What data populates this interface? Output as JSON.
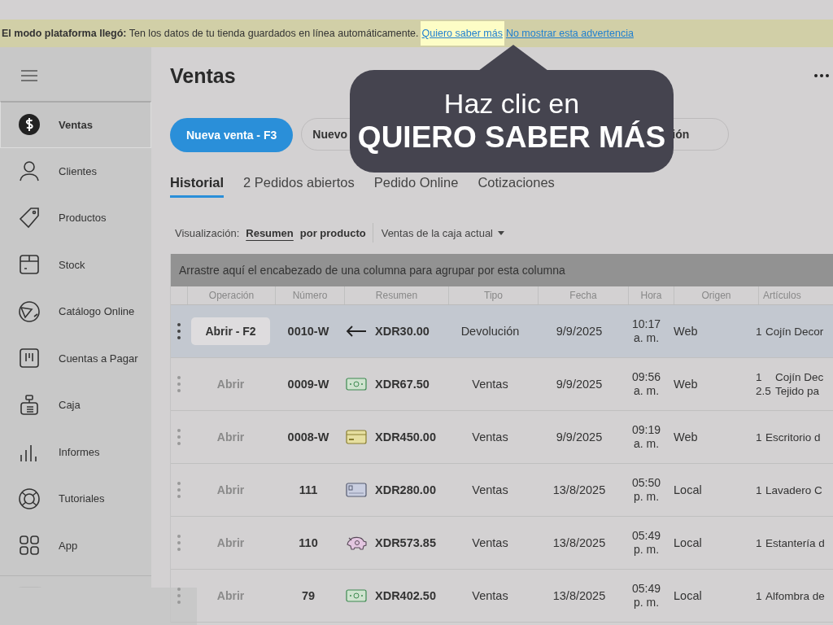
{
  "banner": {
    "message": "**El modo plataforma llegó:** Ten los datos de tu tienda guardados en línea automáticamente.",
    "links": [
      {
        "label": "Quiero saber más",
        "highlighted": true
      },
      {
        "label": "No mostrar esta advertencia",
        "highlighted": false
      }
    ]
  },
  "callout": {
    "line_1": "Haz clic en",
    "line_2": "QUIERO SABER MÁS"
  },
  "sidebar": {
    "items": [
      {
        "label": "Ventas",
        "selected": true
      },
      {
        "label": "Clientes",
        "selected": false
      },
      {
        "label": "Productos",
        "selected": false
      },
      {
        "label": "Stock",
        "selected": false
      },
      {
        "label": "Catálogo Online",
        "selected": false
      },
      {
        "label": "Cuentas a Pagar",
        "selected": false
      },
      {
        "label": "Caja",
        "selected": false
      },
      {
        "label": "Informes",
        "selected": false
      },
      {
        "label": "Tutoriales",
        "selected": false
      },
      {
        "label": "App",
        "selected": false
      }
    ]
  },
  "page": {
    "title": "Ventas"
  },
  "actions": [
    {
      "kind": "primary",
      "label": "Nueva venta - F3"
    },
    {
      "kind": "covered",
      "label": "Nuevo",
      "tail": "ión"
    }
  ],
  "tabs": [
    {
      "label": "Historial",
      "selected": true
    },
    {
      "label": "2 Pedidos abiertos",
      "selected": false
    },
    {
      "label": "Pedido Online",
      "selected": false
    },
    {
      "label": "Cotizaciones",
      "selected": false
    }
  ],
  "view": {
    "label": "Visualización:",
    "options": [
      {
        "label": "Resumen",
        "selected": true
      },
      {
        "label": "por producto",
        "selected": false
      }
    ],
    "filter": "Ventas de la caja actual"
  },
  "table": {
    "group_hint": "Arrastre aquí el encabezado de una columna para agrupar por esta columna",
    "columns": [
      "Operación",
      "Número",
      "Resumen",
      "Tipo",
      "Fecha",
      "Hora",
      "Origen",
      "Artículos"
    ],
    "rows": [
      {
        "selected": true,
        "operation": "Abrir - F2",
        "number": "0010-W",
        "kind": "return",
        "amount": "XDR30.00",
        "type": "Devolución",
        "date": "9/9/2025",
        "time": "10:17",
        "period": "a. m.",
        "origin": "Web",
        "articles": [
          {
            "qty": "1",
            "name": "Cojín Decor"
          }
        ]
      },
      {
        "selected": false,
        "operation": "Abrir",
        "number": "0009-W",
        "kind": "cash",
        "amount": "XDR67.50",
        "type": "Ventas",
        "date": "9/9/2025",
        "time": "09:56",
        "period": "a. m.",
        "origin": "Web",
        "articles": [
          {
            "qty": "1",
            "name": "Cojín Dec"
          },
          {
            "qty": "2.5",
            "name": "Tejido pa"
          }
        ]
      },
      {
        "selected": false,
        "operation": "Abrir",
        "number": "0008-W",
        "kind": "voucher",
        "amount": "XDR450.00",
        "type": "Ventas",
        "date": "9/9/2025",
        "time": "09:19",
        "period": "a. m.",
        "origin": "Web",
        "articles": [
          {
            "qty": "1",
            "name": "Escritorio d"
          }
        ]
      },
      {
        "selected": false,
        "operation": "Abrir",
        "number": "111",
        "kind": "card",
        "amount": "XDR280.00",
        "type": "Ventas",
        "date": "13/8/2025",
        "time": "05:50",
        "period": "p. m.",
        "origin": "Local",
        "articles": [
          {
            "qty": "1",
            "name": "Lavadero C"
          }
        ]
      },
      {
        "selected": false,
        "operation": "Abrir",
        "number": "110",
        "kind": "piggy",
        "amount": "XDR573.85",
        "type": "Ventas",
        "date": "13/8/2025",
        "time": "05:49",
        "period": "p. m.",
        "origin": "Local",
        "articles": [
          {
            "qty": "1",
            "name": "Estantería d"
          }
        ]
      },
      {
        "selected": false,
        "operation": "Abrir",
        "number": "79",
        "kind": "cash",
        "amount": "XDR402.50",
        "type": "Ventas",
        "date": "13/8/2025",
        "time": "05:49",
        "period": "p. m.",
        "origin": "Local",
        "articles": [
          {
            "qty": "1",
            "name": "Alfombra de"
          }
        ]
      }
    ]
  }
}
